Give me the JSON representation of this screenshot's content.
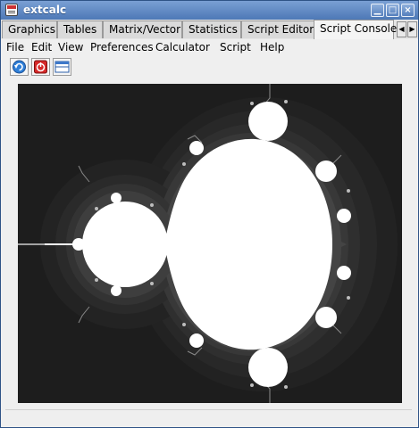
{
  "window": {
    "title": "extcalc"
  },
  "tabs": [
    {
      "label": "Graphics"
    },
    {
      "label": "Tables"
    },
    {
      "label": "Matrix/Vector"
    },
    {
      "label": "Statistics"
    },
    {
      "label": "Script Editor"
    },
    {
      "label": "Script Console",
      "active": true
    }
  ],
  "menu": [
    {
      "label": "File"
    },
    {
      "label": "Edit"
    },
    {
      "label": "View"
    },
    {
      "label": "Preferences"
    },
    {
      "label": "Calculator"
    },
    {
      "label": "Script"
    },
    {
      "label": "Help"
    }
  ],
  "toolbar": [
    {
      "icon": "refresh-icon"
    },
    {
      "icon": "stop-icon"
    },
    {
      "icon": "window-icon"
    }
  ],
  "plot": {
    "content": "Mandelbrot set rendering",
    "background": "#1d1d1d",
    "set_color": "#ffffff"
  }
}
